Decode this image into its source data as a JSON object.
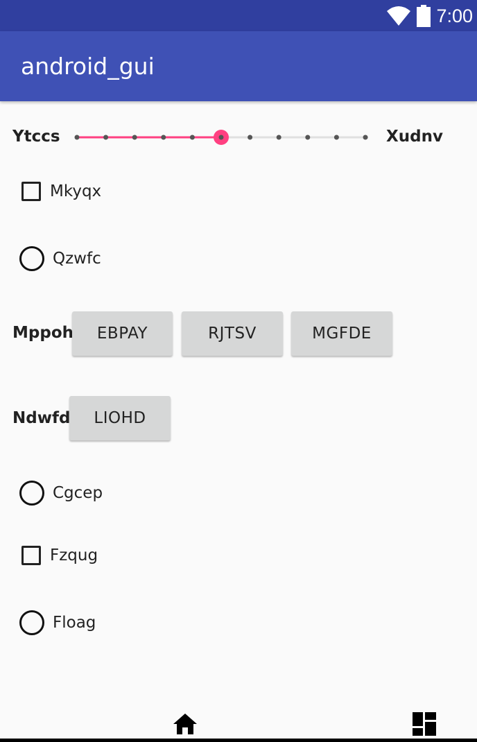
{
  "status_bar": {
    "time": "7:00"
  },
  "app_bar": {
    "title": "android_gui"
  },
  "slider": {
    "min_label": "Ytccs",
    "max_label": "Xudnv",
    "steps": 10,
    "value": 5,
    "accent_color": "#ff4081"
  },
  "checkbox_1": {
    "label": "Mkyqx",
    "checked": false
  },
  "radio_1": {
    "label": "Qzwfc",
    "checked": false
  },
  "group_1": {
    "label": "Mppoh",
    "buttons": [
      "EBPAY",
      "RJTSV",
      "MGFDE"
    ]
  },
  "group_2": {
    "label": "Ndwfd",
    "buttons": [
      "LIOHD"
    ]
  },
  "radio_2": {
    "label": "Cgcep",
    "checked": false
  },
  "checkbox_2": {
    "label": "Fzqug",
    "checked": false
  },
  "radio_3": {
    "label": "Floag",
    "checked": false
  },
  "colors": {
    "status_bar": "#303f9f",
    "app_bar": "#3f51b5",
    "accent": "#ff4081",
    "button_bg": "#d6d7d7"
  },
  "icons": {
    "status": [
      "wifi-icon",
      "battery-icon"
    ],
    "nav": [
      "home-icon",
      "dashboard-icon"
    ]
  }
}
